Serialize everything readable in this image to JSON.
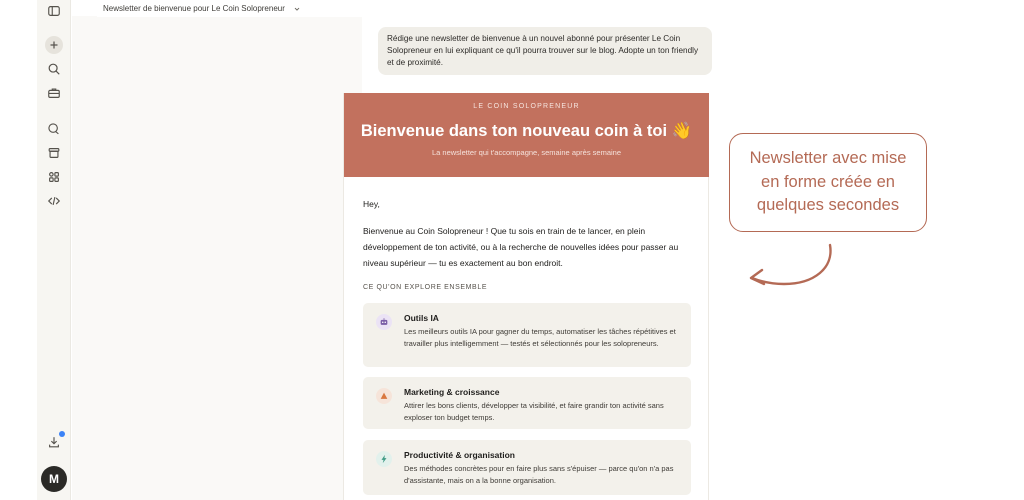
{
  "topbar": {
    "conversation_title": "Newsletter de bienvenue pour Le Coin Solopreneur"
  },
  "sidebar": {
    "icons": [
      "sidebar-toggle-icon",
      "new-chat-icon",
      "search-icon",
      "briefcase-icon",
      "chats-icon",
      "archive-icon",
      "apps-icon",
      "code-icon",
      "download-icon"
    ],
    "avatar_initial": "M",
    "notification_color": "#3b82f6"
  },
  "user_message": "Rédige une newsletter de bienvenue à un nouvel abonné pour présenter Le Coin Solopreneur en lui expliquant ce qu'il pourra trouver sur le blog. Adopte un ton friendly et de proximité.",
  "newsletter": {
    "brand": "LE COIN SOLOPRENEUR",
    "title": "Bienvenue dans ton nouveau coin à toi 👋",
    "subtitle": "La newsletter qui t'accompagne, semaine après semaine",
    "greeting": "Hey,",
    "intro": "Bienvenue au Coin Solopreneur ! Que tu sois en train de te lancer, en plein développement de ton activité, ou à la recherche de nouvelles idées pour passer au niveau supérieur — tu es exactement au bon endroit.",
    "section_title": "CE QU'ON EXPLORE ENSEMBLE",
    "cards": [
      {
        "icon": "robot-icon",
        "title": "Outils IA",
        "description": "Les meilleurs outils IA pour gagner du temps, automatiser les tâches répétitives et travailler plus intelligemment — testés et sélectionnés pour les solopreneurs."
      },
      {
        "icon": "growth-icon",
        "title": "Marketing & croissance",
        "description": "Attirer les bons clients, développer ta visibilité, et faire grandir ton activité sans exploser ton budget temps."
      },
      {
        "icon": "lightning-icon",
        "title": "Productivité & organisation",
        "description": "Des méthodes concrètes pour en faire plus sans s'épuiser — parce qu'on n'a pas d'assistante, mais on a la bonne organisation."
      }
    ],
    "header_color": "#c2715e"
  },
  "annotation": {
    "text": "Newsletter avec mise en forme créée en quelques secondes",
    "color": "#b46a55"
  }
}
